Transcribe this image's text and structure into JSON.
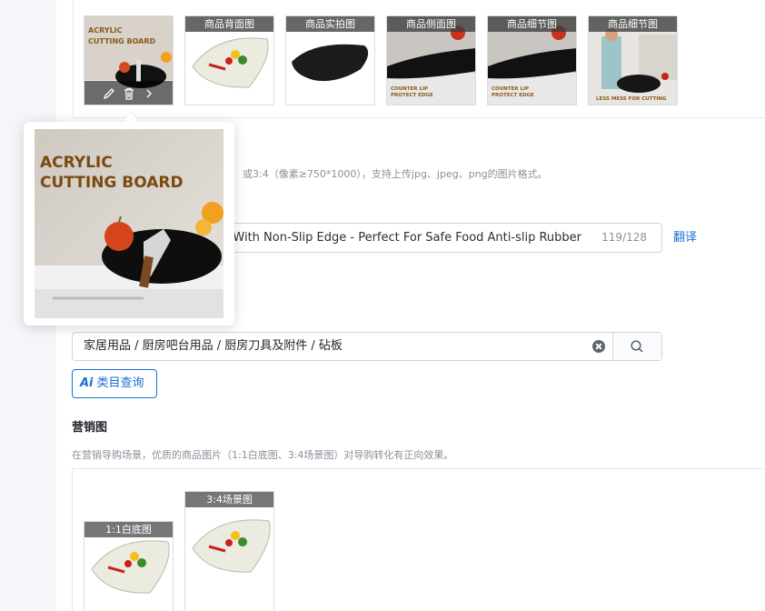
{
  "main_images": [
    {
      "caption": "",
      "icon": "acrylic-board-photo"
    },
    {
      "caption": "商品背面图",
      "icon": "board-back-photo"
    },
    {
      "caption": "商品实拍图",
      "icon": "board-real-photo"
    },
    {
      "caption": "商品侧面图",
      "icon": "board-side-photo"
    },
    {
      "caption": "商品细节图",
      "icon": "board-detail-photo"
    },
    {
      "caption": "商品细节图",
      "icon": "board-detail-photo-2"
    }
  ],
  "thumb_overlays": {
    "title_line1": "ACRYLIC",
    "title_line2": "CUTTING BOARD",
    "counter_lip_1": "COUNTER LIP",
    "counter_lip_2": "PROTECT EDGE",
    "less_mess": "LESS MESS FOR CUTTING"
  },
  "preview": {
    "title_line1": "ACRYLIC",
    "title_line2": "CUTTING BOARD"
  },
  "image_hint": "或3:4（像素≥750*1000），支持上传jpg、jpeg、png的图片格式。",
  "title_field": {
    "value": "ard With Non-Slip Edge - Perfect For Safe Food Anti-slip Rubber",
    "count": "119/128"
  },
  "translate_label": "翻译",
  "category_field": {
    "value": "家居用品 / 厨房吧台用品 / 厨房刀具及附件 / 砧板"
  },
  "ai_button": {
    "icon_text": "Ai",
    "label": "类目查询"
  },
  "marketing": {
    "title": "营销图",
    "hint": "在营销导购场景，优质的商品图片（1:1白底图、3:4场景图）对导购转化有正向效果。",
    "images": [
      {
        "caption": "1:1白底图"
      },
      {
        "caption": "3:4场景图"
      }
    ]
  },
  "colors": {
    "accent": "#1a6fd6",
    "border": "#d0d4da",
    "hint": "#8a8f99"
  }
}
